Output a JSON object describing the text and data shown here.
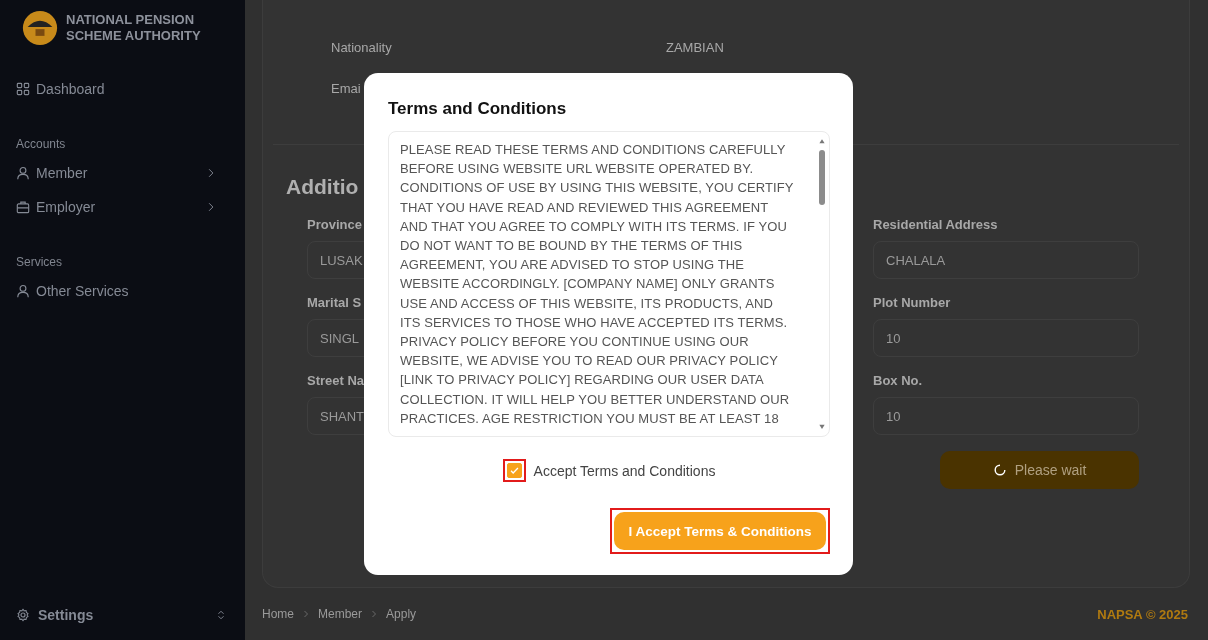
{
  "sidebar": {
    "logo_text": "NATIONAL PENSION SCHEME AUTHORITY",
    "nav": [
      {
        "kind": "link",
        "label": "Dashboard",
        "expandable": false
      },
      {
        "kind": "heading",
        "label": "Accounts"
      },
      {
        "kind": "link",
        "label": "Member",
        "expandable": true
      },
      {
        "kind": "link",
        "label": "Employer",
        "expandable": true
      },
      {
        "kind": "heading",
        "label": "Services"
      },
      {
        "kind": "link",
        "label": "Other Services",
        "expandable": false
      }
    ],
    "footer": {
      "label": "Settings"
    }
  },
  "details": [
    {
      "label": "Nationality",
      "value": "ZAMBIAN"
    },
    {
      "label": "Emai"
    }
  ],
  "section_title": "Additio",
  "form": {
    "left": [
      {
        "label": "Province",
        "value": "LUSAK"
      },
      {
        "label": "Marital S",
        "value": "SINGL"
      },
      {
        "label": "Street Na",
        "value": "SHANT"
      }
    ],
    "right": [
      {
        "label": "Residential Address",
        "value": "CHALALA"
      },
      {
        "label": "Plot Number",
        "value": "10"
      },
      {
        "label": "Box No.",
        "value": "10"
      }
    ],
    "submit": {
      "label": "Please wait",
      "loading": true
    }
  },
  "breadcrumb": [
    "Home",
    "Member",
    "Apply"
  ],
  "copyright": "NAPSA © 2025",
  "modal": {
    "title": "Terms and Conditions",
    "body": "PLEASE READ THESE TERMS AND CONDITIONS CAREFULLY BEFORE USING WEBSITE URL WEBSITE  OPERATED BY. CONDITIONS OF USE BY USING THIS WEBSITE, YOU CERTIFY THAT YOU HAVE READ AND REVIEWED THIS AGREEMENT AND THAT YOU AGREE TO COMPLY WITH ITS TERMS. IF YOU DO NOT WANT TO BE BOUND BY THE TERMS OF THIS AGREEMENT, YOU ARE ADVISED TO STOP USING THE WEBSITE ACCORDINGLY. [COMPANY NAME] ONLY GRANTS USE AND ACCESS OF THIS WEBSITE, ITS PRODUCTS, AND ITS SERVICES TO THOSE WHO HAVE ACCEPTED ITS TERMS. PRIVACY POLICY BEFORE YOU CONTINUE USING OUR WEBSITE, WE ADVISE YOU TO READ OUR PRIVACY POLICY [LINK TO PRIVACY POLICY] REGARDING OUR USER DATA COLLECTION. IT WILL HELP YOU BETTER UNDERSTAND OUR PRACTICES. AGE RESTRICTION YOU MUST BE AT LEAST 18",
    "checkbox": {
      "label": "Accept Terms and Conditions",
      "checked": true,
      "highlighted": true
    },
    "button": {
      "label": "I Accept Terms & Conditions",
      "highlighted": true
    }
  }
}
